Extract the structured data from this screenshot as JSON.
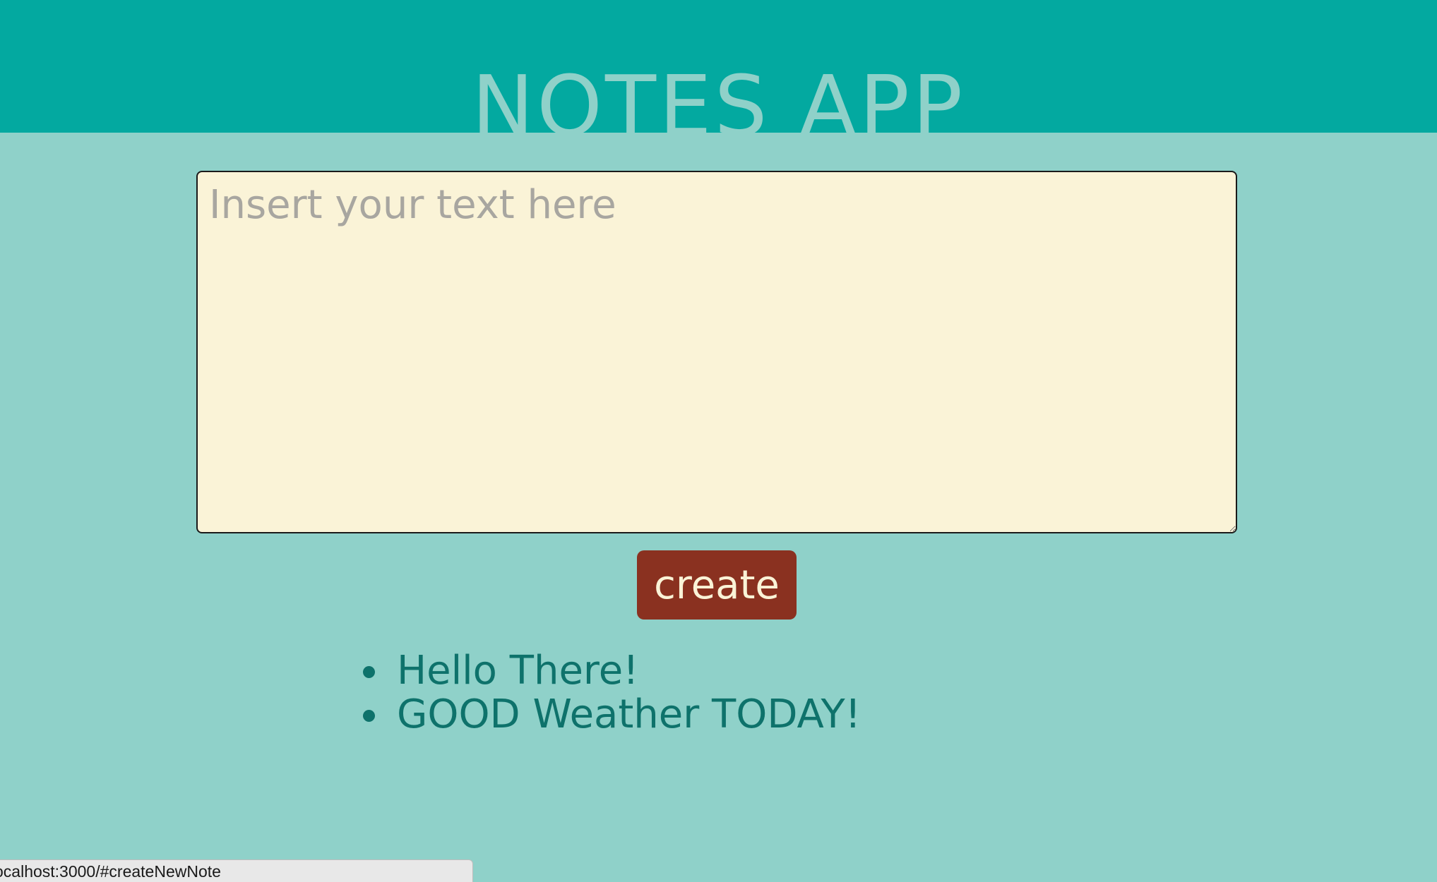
{
  "header": {
    "title": "NOTES APP"
  },
  "editor": {
    "placeholder": "Insert your text here",
    "value": ""
  },
  "actions": {
    "create_label": "create"
  },
  "notes": [
    "Hello There!",
    "GOOD Weather TODAY!"
  ],
  "status_bar": {
    "url": "ocalhost:3000/#createNewNote"
  },
  "colors": {
    "header_bg": "#03a9a0",
    "page_bg": "#8fd1c9",
    "editor_bg": "#faf3d7",
    "button_bg": "#8a3120",
    "note_text": "#0e726b"
  }
}
